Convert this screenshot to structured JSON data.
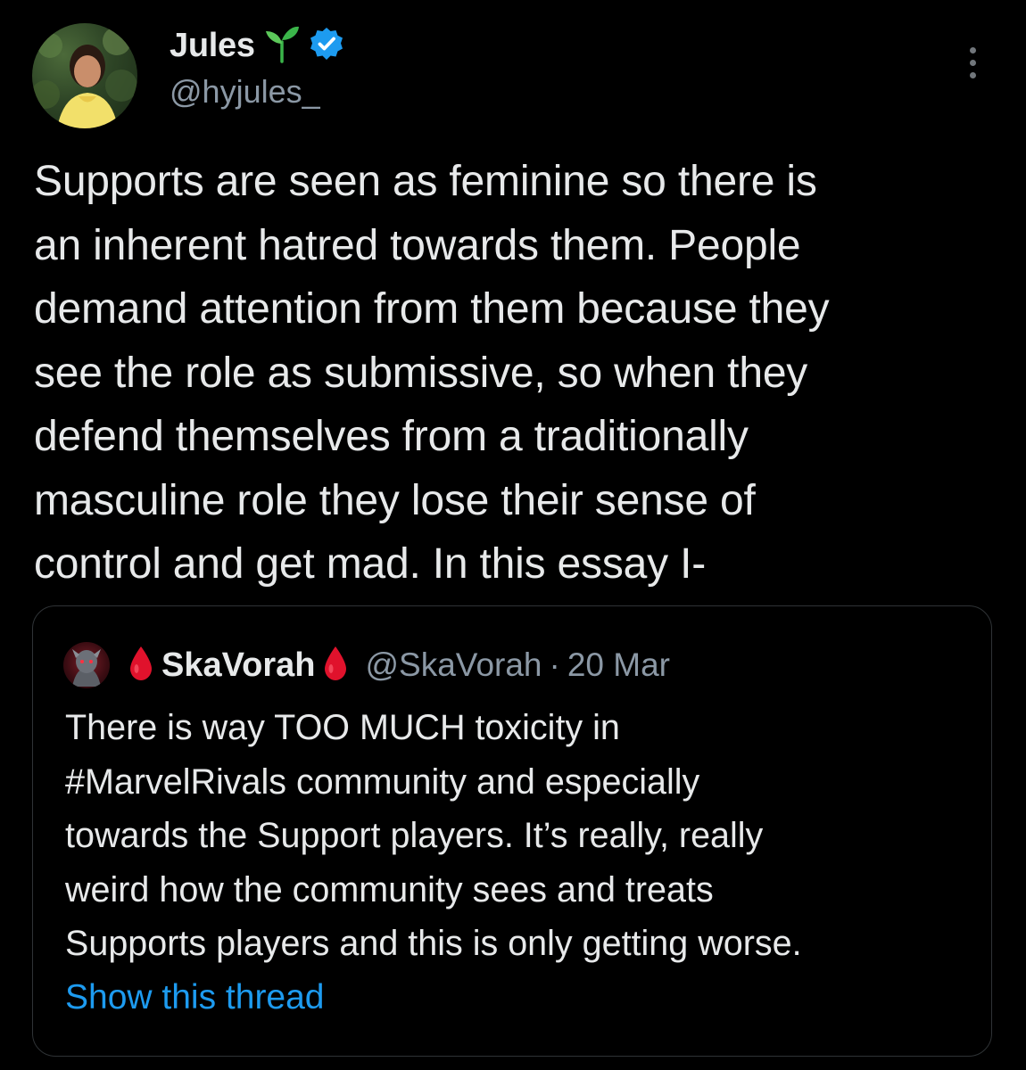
{
  "tweet": {
    "author": {
      "display_name": "Jules",
      "emoji": "🌱",
      "verified_icon": "verified-badge-icon",
      "handle": "@hyjules_"
    },
    "more_icon": "more-vertical-icon",
    "text": "Supports are seen as feminine so there is\nan inherent hatred towards them. People\ndemand attention from them because they\nsee the role as submissive, so when they\ndefend themselves from a traditionally\nmasculine role they lose their sense of\ncontrol and get mad. In this essay I-"
  },
  "quote": {
    "author": {
      "display_name": "SkaVorah",
      "handle": "@SkaVorah",
      "separator": "·",
      "date": "20 Mar",
      "name_icon": "blood-drop-icon"
    },
    "text": "There is way TOO MUCH toxicity in\n#MarvelRivals community and especially\ntowards the Support players. It’s really, really\nweird how the community sees and treats\nSupports players and this is only getting worse.",
    "show_thread_label": "Show this thread"
  },
  "colors": {
    "background": "#000000",
    "primary_text": "#e7e9ea",
    "secondary_text": "#8b98a5",
    "link": "#1d9bf0",
    "border": "#2f3336",
    "verified": "#1d9bf0",
    "drop": "#e0122c"
  }
}
